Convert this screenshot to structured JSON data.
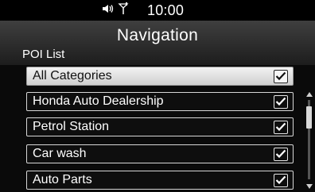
{
  "status": {
    "time": "10:00",
    "icons": [
      "speaker-icon",
      "signal-icon"
    ]
  },
  "header": {
    "title": "Navigation",
    "subtitle": "POI List"
  },
  "list": {
    "items": [
      {
        "label": "All Categories",
        "checked": true,
        "selected": true
      },
      {
        "label": "Honda Auto Dealership",
        "checked": true,
        "selected": false
      },
      {
        "label": "Petrol Station",
        "checked": true,
        "selected": false
      },
      {
        "label": "Car wash",
        "checked": true,
        "selected": false
      },
      {
        "label": "Auto Parts",
        "checked": true,
        "selected": false
      }
    ]
  },
  "colors": {
    "background": "#000000",
    "text": "#ffffff",
    "row_border": "#d7d7d7",
    "selected_row": "#e2e2e2"
  }
}
